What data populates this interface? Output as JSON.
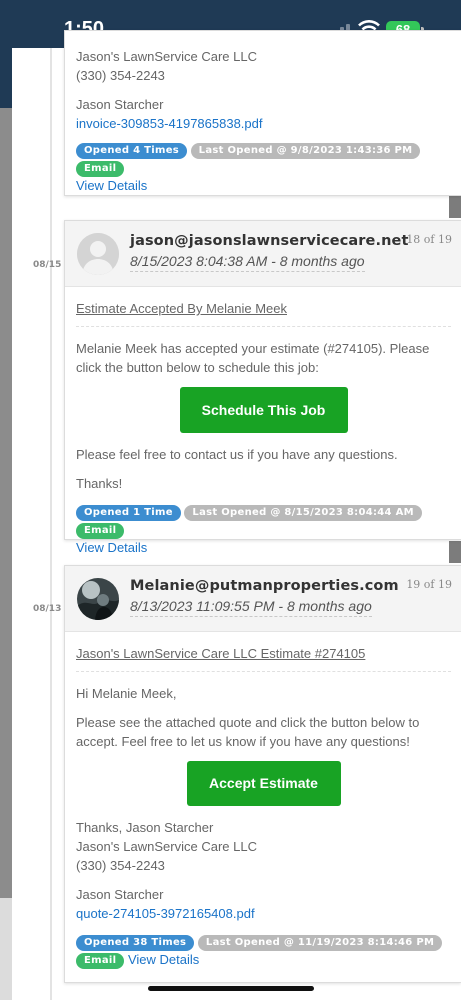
{
  "status_bar": {
    "time": "1:50",
    "battery": "68"
  },
  "card_top": {
    "lines": [
      "Jason's LawnService Care LLC",
      "(330) 354-2243"
    ],
    "signer": "Jason Starcher",
    "attachment": "invoice-309853-4197865838.pdf",
    "badges": {
      "opened": "Opened 4 Times",
      "last": "Last Opened @ 9/8/2023 1:43:36 PM",
      "email": "Email"
    },
    "view_details": "View Details"
  },
  "card_18": {
    "date_label": "08/15",
    "sender": "jason@jasonslawnservicecare.net",
    "sent_at": "8/15/2023 8:04:38 AM - 8 months ago",
    "counter": "18 of 19",
    "subject": "Estimate Accepted By Melanie Meek",
    "body": "Melanie Meek has accepted your estimate (#274105). Please click the button below to schedule this job:",
    "cta": "Schedule This Job",
    "contact": "Please feel free to contact us if you have any questions.",
    "thanks": "Thanks!",
    "badges": {
      "opened": "Opened 1 Time",
      "last": "Last Opened @ 8/15/2023 8:04:44 AM",
      "email": "Email"
    },
    "view_details": "View Details"
  },
  "card_19": {
    "date_label": "08/13",
    "sender": "Melanie@putmanproperties.com",
    "sent_at": "8/13/2023 11:09:55 PM - 8 months ago",
    "counter": "19 of 19",
    "subject": "Jason's LawnService Care LLC Estimate #274105",
    "greeting": "Hi Melanie Meek,",
    "body": "Please see the attached quote and click the button below to accept. Feel free to let us know if you have any questions!",
    "cta": "Accept Estimate",
    "signoff": [
      "Thanks, Jason Starcher",
      "Jason's LawnService Care LLC",
      "(330) 354-2243"
    ],
    "signer": "Jason Starcher",
    "attachment": "quote-274105-3972165408.pdf",
    "badges": {
      "opened": "Opened 38 Times",
      "last": "Last Opened @ 11/19/2023 8:14:46 PM",
      "email": "Email"
    },
    "view_details": "View Details"
  }
}
